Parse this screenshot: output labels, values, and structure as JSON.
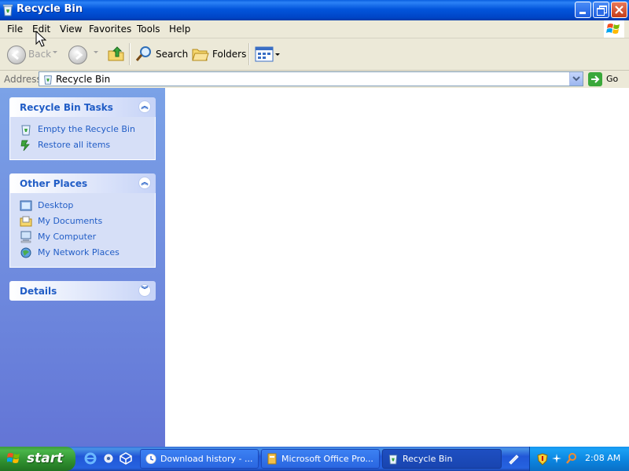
{
  "window": {
    "title": "Recycle Bin"
  },
  "menu": {
    "items": [
      "File",
      "Edit",
      "View",
      "Favorites",
      "Tools",
      "Help"
    ]
  },
  "toolbar": {
    "back_label": "Back",
    "search_label": "Search",
    "folders_label": "Folders"
  },
  "address": {
    "label": "Address",
    "value": "Recycle Bin",
    "go_label": "Go"
  },
  "taskpane": {
    "recycle_tasks": {
      "title": "Recycle Bin Tasks",
      "items": [
        "Empty the Recycle Bin",
        "Restore all items"
      ]
    },
    "other_places": {
      "title": "Other Places",
      "items": [
        "Desktop",
        "My Documents",
        "My Computer",
        "My Network Places"
      ]
    },
    "details": {
      "title": "Details"
    }
  },
  "taskbar": {
    "start_label": "start",
    "buttons": [
      "Download history - ...",
      "Microsoft Office Pro...",
      "Recycle Bin"
    ],
    "clock": "2:08 AM"
  },
  "colors": {
    "title_bar": "#0054E3",
    "task_pane": "#6F8FE0",
    "task_link": "#215DC6",
    "taskbar": "#245EDB",
    "start_button": "#3C9A3C"
  }
}
